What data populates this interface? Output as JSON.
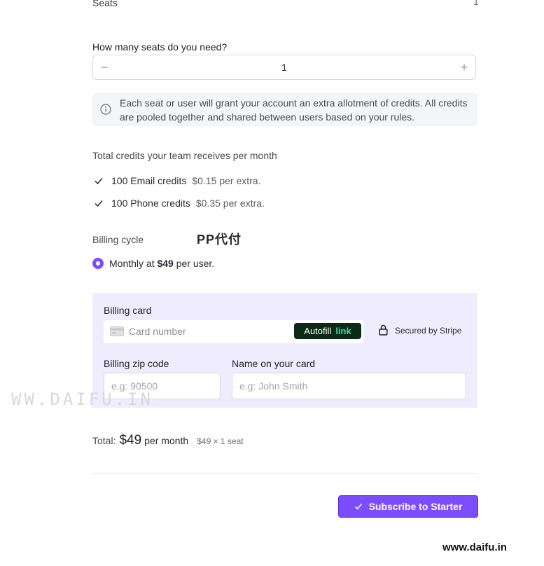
{
  "seats": {
    "label": "Seats",
    "value": "1"
  },
  "stepper": {
    "label": "How many seats do you need?",
    "value": "1",
    "minus": "−",
    "plus": "+"
  },
  "info": {
    "text": "Each seat or user will grant your account an extra allotment of credits. All credits are pooled together and shared between users based on your rules.",
    "icon": "info-circle-icon"
  },
  "credits": {
    "title": "Total credits your team receives per month",
    "items": [
      {
        "label": "100 Email credits",
        "extra": "$0.15 per extra."
      },
      {
        "label": "100 Phone credits",
        "extra": "$0.35 per extra."
      }
    ]
  },
  "billing": {
    "cycle_label": "Billing cycle",
    "option_prefix": "Monthly at",
    "option_price": "$49",
    "option_suffix": "per user."
  },
  "card": {
    "label": "Billing card",
    "placeholder": "Card number",
    "autofill": "Autofill",
    "autofill_link": "link",
    "secured": "Secured by Stripe",
    "zip_label": "Billing zip code",
    "zip_placeholder": "e.g: 90500",
    "name_label": "Name on your card",
    "name_placeholder": "e.g: John Smith"
  },
  "total": {
    "label": "Total:",
    "amount": "$49",
    "period": "per month",
    "breakdown": "$49 × 1 seat"
  },
  "subscribe": {
    "label": "Subscribe to Starter"
  },
  "watermarks": {
    "center": "PP代付",
    "left": "WW.DAIFU.IN",
    "bottom": "www.daifu.in"
  },
  "colors": {
    "accent": "#7c4dff",
    "panel": "#efecfd",
    "autofill_bg": "#0c2b16",
    "autofill_link": "#33ddb3"
  }
}
